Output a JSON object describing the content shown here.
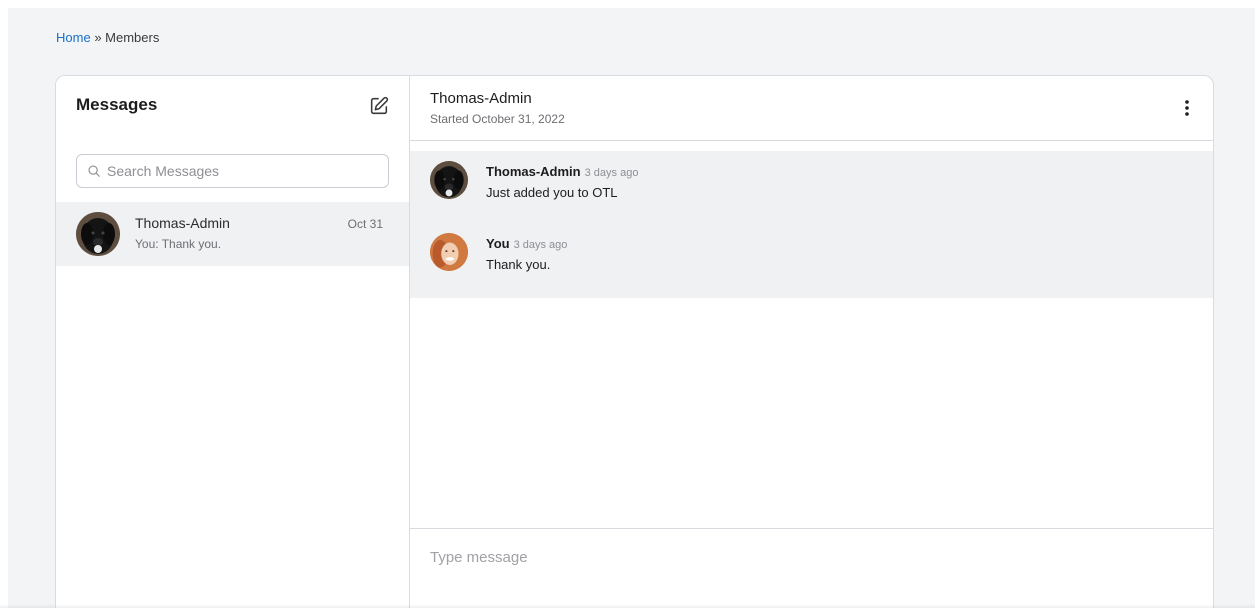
{
  "breadcrumb": {
    "home": "Home",
    "separator": "»",
    "current": "Members"
  },
  "sidebar": {
    "title": "Messages",
    "compose_icon": "compose-icon",
    "search": {
      "placeholder": "Search Messages",
      "value": ""
    },
    "threads": [
      {
        "name": "Thomas-Admin",
        "preview": "You: Thank you.",
        "date": "Oct 31",
        "selected": true
      }
    ]
  },
  "conversation": {
    "title": "Thomas-Admin",
    "subtitle": "Started October 31, 2022",
    "menu_icon": "more-vertical-icon",
    "messages": [
      {
        "author": "Thomas-Admin",
        "time": "3 days ago",
        "text": "Just added you to OTL"
      },
      {
        "author": "You",
        "time": "3 days ago",
        "text": "Thank you."
      }
    ],
    "composer": {
      "placeholder": "Type message",
      "value": ""
    }
  },
  "colors": {
    "link": "#1a6fc9",
    "page_bg": "#f3f4f6",
    "selected_bg": "#f0f1f3",
    "border": "#d9dbe0"
  }
}
